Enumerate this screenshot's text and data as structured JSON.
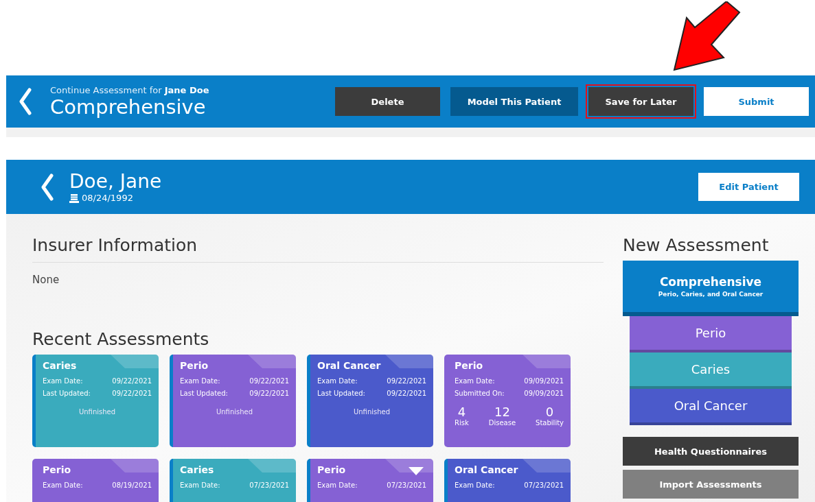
{
  "annotation": {
    "arrow": true
  },
  "top_bar": {
    "subtitle": "Continue Assessment for **Jane Doe**",
    "title": "Comprehensive",
    "buttons": [
      {
        "label": "Delete",
        "kind": "dark",
        "highlighted": false
      },
      {
        "label": "Model This Patient",
        "kind": "navy",
        "highlighted": false
      },
      {
        "label": "Save for Later",
        "kind": "dark",
        "highlighted": true
      },
      {
        "label": "Submit",
        "kind": "light",
        "highlighted": false
      }
    ]
  },
  "patient": {
    "name": "Doe, Jane",
    "birth_date": "08/24/1992",
    "edit_button": "Edit Patient"
  },
  "insurer": {
    "heading": "Insurer Information",
    "value": "None"
  },
  "recent": {
    "heading": "Recent Assessments",
    "cards": [
      {
        "title": "Caries",
        "color": "#3aabbd",
        "flagged": true,
        "kind": "status",
        "rows": [
          {
            "label": "Exam Date:",
            "value": "09/22/2021"
          },
          {
            "label": "Last Updated:",
            "value": "09/22/2021"
          }
        ],
        "status": "Unfinished"
      },
      {
        "title": "Perio",
        "color": "#8561d4",
        "flagged": true,
        "kind": "status",
        "rows": [
          {
            "label": "Exam Date:",
            "value": "09/22/2021"
          },
          {
            "label": "Last Updated:",
            "value": "09/22/2021"
          }
        ],
        "status": "Unfinished"
      },
      {
        "title": "Oral Cancer",
        "color": "#4b5acb",
        "flagged": true,
        "kind": "status",
        "rows": [
          {
            "label": "Exam Date:",
            "value": "09/22/2021"
          },
          {
            "label": "Last Updated:",
            "value": "09/22/2021"
          }
        ],
        "status": "Unfinished"
      },
      {
        "title": "Perio",
        "color": "#8561d4",
        "flagged": false,
        "kind": "scores",
        "rows": [
          {
            "label": "Exam Date:",
            "value": "09/09/2021"
          },
          {
            "label": "Submitted On:",
            "value": "09/09/2021"
          }
        ],
        "scores": [
          {
            "value": "4",
            "label": "Risk"
          },
          {
            "value": "12",
            "label": "Disease"
          },
          {
            "value": "0",
            "label": "Stability"
          }
        ]
      },
      {
        "title": "Perio",
        "color": "#8561d4",
        "flagged": false,
        "kind": "partial",
        "rows": [
          {
            "label": "Exam Date:",
            "value": "08/19/2021"
          }
        ]
      },
      {
        "title": "Caries",
        "color": "#3aabbd",
        "flagged": true,
        "kind": "partial",
        "rows": [
          {
            "label": "Exam Date:",
            "value": "07/23/2021"
          }
        ]
      },
      {
        "title": "Perio",
        "color": "#8561d4",
        "flagged": true,
        "kind": "partial",
        "rows": [
          {
            "label": "Exam Date:",
            "value": "07/23/2021"
          }
        ],
        "menu_caret": true
      },
      {
        "title": "Oral Cancer",
        "color": "#4b5acb",
        "flagged": true,
        "kind": "partial",
        "rows": [
          {
            "label": "Exam Date:",
            "value": "07/23/2021"
          }
        ]
      }
    ]
  },
  "new_assessment": {
    "heading": "New Assessment",
    "main": {
      "title": "Comprehensive",
      "subtitle": "Perio, Caries, and Oral Cancer",
      "color": "#0a7fc8"
    },
    "options": [
      {
        "label": "Perio",
        "color": "#8561d4"
      },
      {
        "label": "Caries",
        "color": "#3aabbd"
      },
      {
        "label": "Oral Cancer",
        "color": "#4b5acb"
      }
    ],
    "actions": [
      {
        "label": "Health Questionnaires",
        "kind": "dark"
      },
      {
        "label": "Import Assessments",
        "kind": "gray"
      }
    ]
  }
}
